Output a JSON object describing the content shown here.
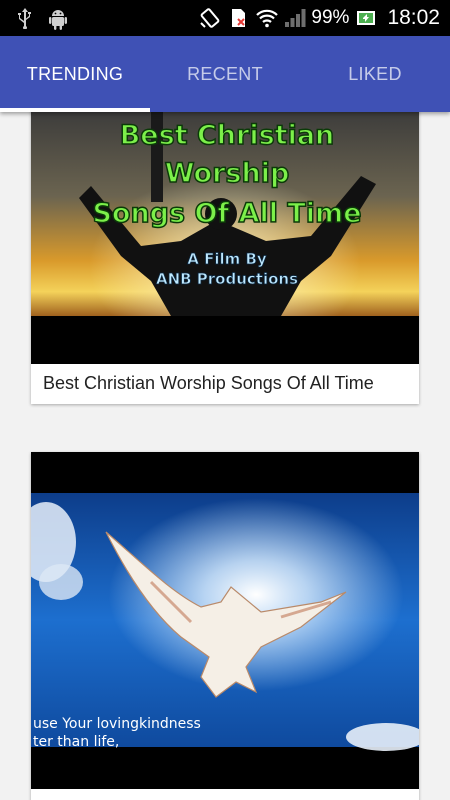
{
  "status_bar": {
    "battery": "99%",
    "time": "18:02"
  },
  "tabs": [
    {
      "label": "TRENDING",
      "active": true
    },
    {
      "label": "RECENT",
      "active": false
    },
    {
      "label": "LIKED",
      "active": false
    }
  ],
  "videos": [
    {
      "title": "Best Christian Worship Songs Of All Time",
      "thumbnail_text": {
        "line1": "Best Christian",
        "line2": "Worship",
        "line3": "Songs Of All Time",
        "credit1": "A Film By",
        "credit2": "ANB Productions"
      }
    },
    {
      "title": "",
      "thumbnail_text": {
        "line1": "use Your lovingkindness",
        "line2": "ter than life,"
      }
    }
  ],
  "colors": {
    "app_bar": "#3f51b5",
    "background": "#f2f2f2"
  }
}
